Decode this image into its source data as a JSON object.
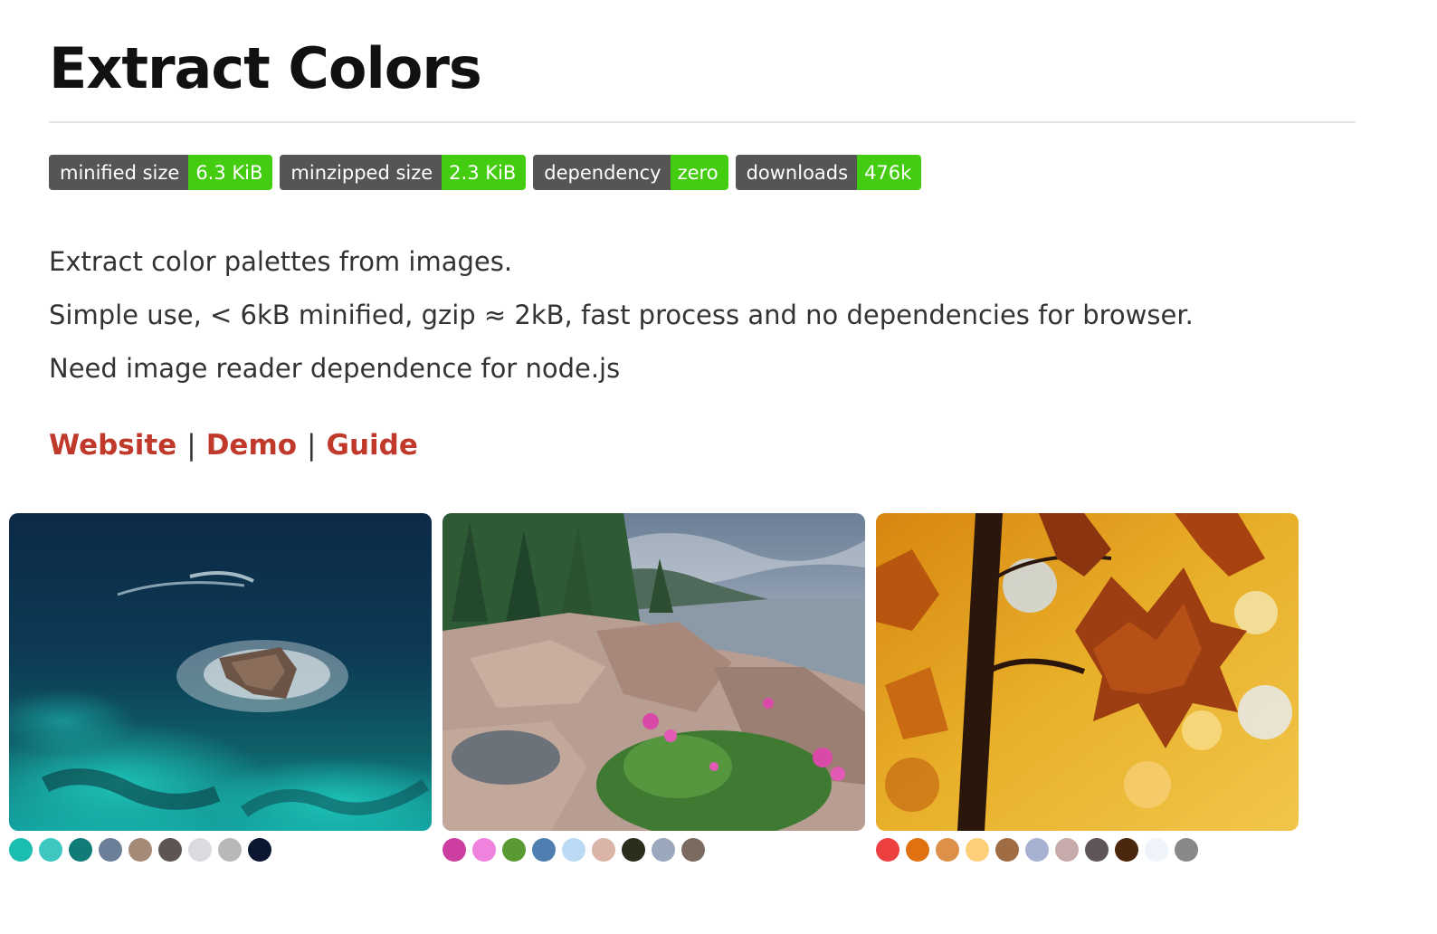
{
  "title": "Extract Colors",
  "badges": [
    {
      "key": "minified size",
      "value": "6.3 KiB"
    },
    {
      "key": "minzipped size",
      "value": "2.3 KiB"
    },
    {
      "key": "dependency",
      "value": "zero"
    },
    {
      "key": "downloads",
      "value": "476k"
    }
  ],
  "description": [
    "Extract color palettes from images.",
    "Simple use, < 6kB minified, gzip ≈ 2kB, fast process and no dependencies for browser.",
    "Need image reader dependence for node.js"
  ],
  "links": [
    "Website",
    "Demo",
    "Guide"
  ],
  "colors": {
    "link": "#c0392b",
    "badge_key": "#555555",
    "badge_value": "#44cc11"
  },
  "gallery": [
    {
      "image": "ocean-rock-photo",
      "swatches": [
        "#1bbdb0",
        "#3ec7c0",
        "#0f7c78",
        "#6b7f99",
        "#a58a78",
        "#5e5553",
        "#d9dbe0",
        "#b8b8b8",
        "#0b1630"
      ]
    },
    {
      "image": "rocky-coast-flowers-photo",
      "swatches": [
        "#cc3fa0",
        "#ee82dc",
        "#5a9a35",
        "#4f7fb0",
        "#bcdaf5",
        "#d9b4a7",
        "#2a2f1d",
        "#9aa7bd",
        "#7a6a60"
      ]
    },
    {
      "image": "autumn-leaves-photo",
      "swatches": [
        "#ee4040",
        "#e07010",
        "#dd9048",
        "#fccf78",
        "#a06c44",
        "#a7b1d2",
        "#c7aaaa",
        "#5f5457",
        "#4a260c",
        "#eef4fa",
        "#888888"
      ]
    }
  ]
}
